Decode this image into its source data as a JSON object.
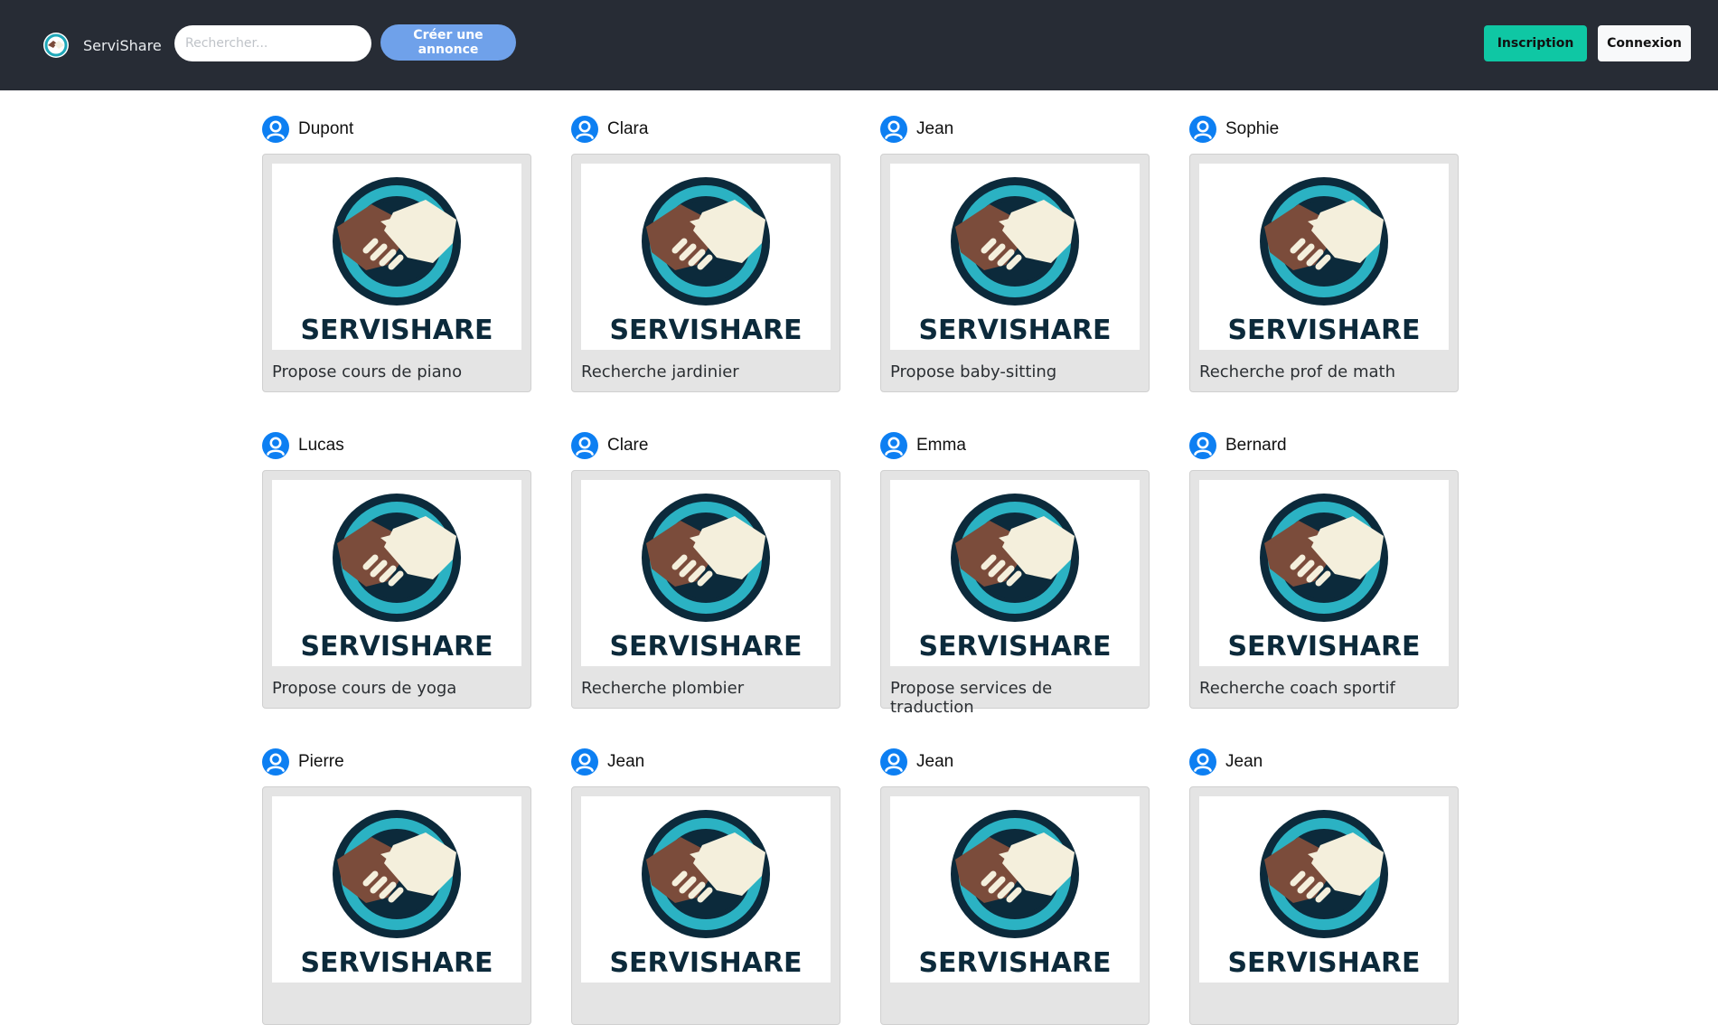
{
  "navbar": {
    "brand_name": "ServiShare",
    "search_placeholder": "Rechercher...",
    "create_label": "Créer une annonce",
    "signup_label": "Inscription",
    "login_label": "Connexion"
  },
  "colors": {
    "navbar_bg": "#272c35",
    "create_button": "#6fa1ea",
    "signup_button": "#0fc7a4",
    "avatar_icon": "#0d7ff2"
  },
  "logo_text": "SERVISHARE",
  "listings": [
    {
      "author": "Dupont",
      "title": "Propose cours de piano"
    },
    {
      "author": "Clara",
      "title": "Recherche jardinier"
    },
    {
      "author": "Jean",
      "title": "Propose baby-sitting"
    },
    {
      "author": "Sophie",
      "title": "Recherche prof de math"
    },
    {
      "author": "Lucas",
      "title": "Propose cours de yoga"
    },
    {
      "author": "Clare",
      "title": "Recherche plombier"
    },
    {
      "author": "Emma",
      "title": "Propose services de traduction"
    },
    {
      "author": "Bernard",
      "title": "Recherche coach sportif"
    },
    {
      "author": "Pierre",
      "title": ""
    },
    {
      "author": "Jean",
      "title": ""
    },
    {
      "author": "Jean",
      "title": ""
    },
    {
      "author": "Jean",
      "title": ""
    }
  ]
}
